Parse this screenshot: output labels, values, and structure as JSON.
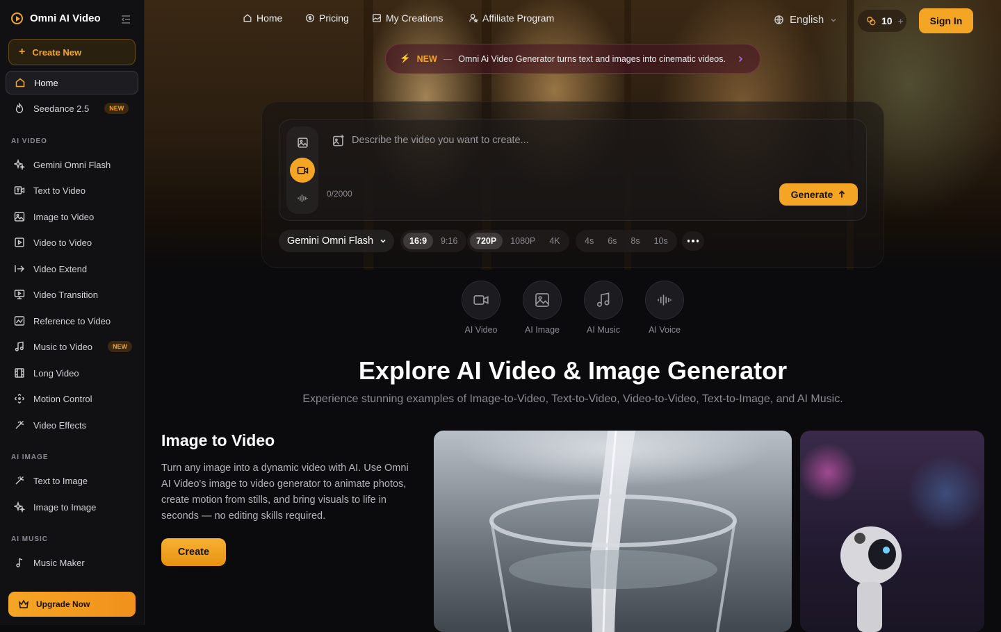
{
  "brand": {
    "name": "Omni AI Video"
  },
  "sidebar": {
    "create_new": "Create New",
    "items": [
      {
        "label": "Home",
        "icon": "home-icon"
      },
      {
        "label": "Seedance 2.5",
        "icon": "flame-icon",
        "badge": "NEW"
      }
    ],
    "sections": [
      {
        "title": "AI VIDEO",
        "items": [
          {
            "label": "Gemini Omni Flash",
            "icon": "sparkles-icon"
          },
          {
            "label": "Text to Video",
            "icon": "text-video-icon"
          },
          {
            "label": "Image to Video",
            "icon": "image-video-icon"
          },
          {
            "label": "Video to Video",
            "icon": "play-square-icon"
          },
          {
            "label": "Video Extend",
            "icon": "arrow-extend-icon"
          },
          {
            "label": "Video Transition",
            "icon": "presentation-icon"
          },
          {
            "label": "Reference to Video",
            "icon": "chart-image-icon"
          },
          {
            "label": "Music to Video",
            "icon": "music-note-icon",
            "badge": "NEW"
          },
          {
            "label": "Long Video",
            "icon": "film-icon"
          },
          {
            "label": "Motion Control",
            "icon": "move-icon"
          },
          {
            "label": "Video Effects",
            "icon": "wand-icon"
          }
        ]
      },
      {
        "title": "AI IMAGE",
        "items": [
          {
            "label": "Text to Image",
            "icon": "wand-icon"
          },
          {
            "label": "Image to Image",
            "icon": "sparkles-icon"
          }
        ]
      },
      {
        "title": "AI MUSIC",
        "items": [
          {
            "label": "Music Maker",
            "icon": "music-single-icon"
          }
        ]
      }
    ],
    "upgrade": "Upgrade Now"
  },
  "header": {
    "nav": [
      {
        "label": "Home",
        "icon": "home-icon"
      },
      {
        "label": "Pricing",
        "icon": "price-tag-icon"
      },
      {
        "label": "My Creations",
        "icon": "gallery-icon"
      },
      {
        "label": "Affiliate Program",
        "icon": "user-star-icon"
      }
    ],
    "language": "English",
    "credits": "10",
    "sign_in": "Sign In"
  },
  "announcement": {
    "tag": "NEW",
    "separator": "—",
    "text": "Omni Ai Video Generator turns text and images into cinematic videos."
  },
  "generator": {
    "placeholder": "Describe the video you want to create...",
    "counter": "0/2000",
    "generate": "Generate",
    "model": "Gemini Omni Flash",
    "aspect_ratios": [
      {
        "label": "16:9",
        "selected": true
      },
      {
        "label": "9:16",
        "selected": false
      }
    ],
    "resolutions": [
      {
        "label": "720P",
        "selected": true
      },
      {
        "label": "1080P",
        "selected": false
      },
      {
        "label": "4K",
        "selected": false
      }
    ],
    "durations": [
      {
        "label": "4s"
      },
      {
        "label": "6s"
      },
      {
        "label": "8s"
      },
      {
        "label": "10s"
      }
    ],
    "active_mode": "video"
  },
  "categories": [
    {
      "label": "AI Video",
      "icon": "video-camera-icon"
    },
    {
      "label": "AI Image",
      "icon": "image-icon"
    },
    {
      "label": "AI Music",
      "icon": "music-note-icon"
    },
    {
      "label": "AI Voice",
      "icon": "waveform-icon"
    }
  ],
  "explore": {
    "title": "Explore AI Video & Image Generator",
    "subtitle": "Experience stunning examples of Image-to-Video, Text-to-Video, Video-to-Video, Text-to-Image, and AI Music."
  },
  "feature": {
    "title": "Image to Video",
    "description": "Turn any image into a dynamic video with AI. Use Omni AI Video's image to video generator to animate photos, create motion from stills, and bring visuals to life in seconds — no editing skills required.",
    "cta": "Create"
  },
  "colors": {
    "accent": "#f5a524",
    "background": "#0b0b0d",
    "sidebar": "#111113"
  }
}
